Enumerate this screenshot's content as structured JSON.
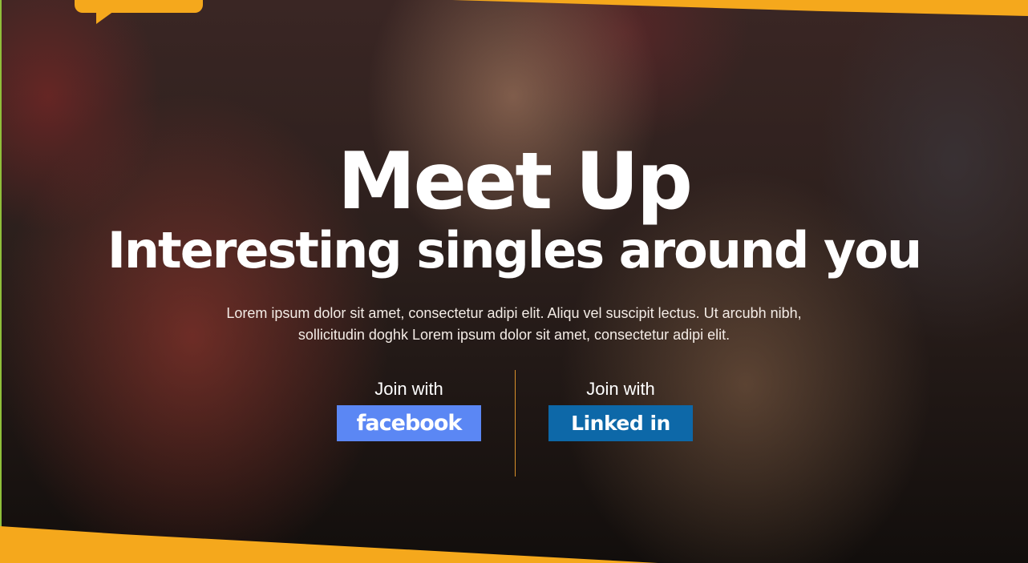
{
  "hero": {
    "title": "Meet Up",
    "subtitle": "Interesting singles around you",
    "description": "Lorem ipsum dolor sit amet, consectetur adipi elit. Aliqu vel suscipit lectus. Ut arcubh nibh, sollicitudin doghk Lorem ipsum dolor sit amet, consectetur adipi elit."
  },
  "join": {
    "facebook": {
      "label": "Join with",
      "button": "facebook"
    },
    "linkedin": {
      "label": "Join with",
      "button": "Linked in"
    }
  },
  "colors": {
    "accent": "#f5a81c",
    "facebook": "#5b87f4",
    "linkedin": "#0d68a8",
    "divider": "#d9902a"
  }
}
